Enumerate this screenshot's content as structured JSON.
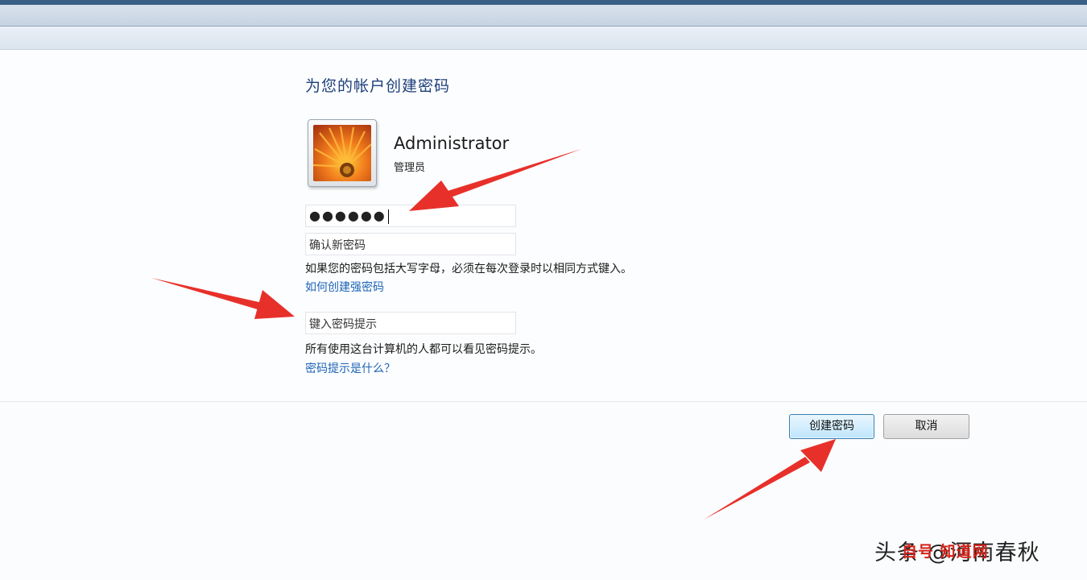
{
  "page": {
    "title": "为您的帐户创建密码"
  },
  "user": {
    "name": "Administrator",
    "role": "管理员",
    "avatar_icon": "flower-avatar-icon"
  },
  "form": {
    "password_value": "●●●●●●",
    "confirm_placeholder": "确认新密码",
    "caps_warning": "如果您的密码包括大写字母，必须在每次登录时以相同方式键入。",
    "create_strong_link": "如何创建强密码",
    "hint_placeholder": "键入密码提示",
    "hint_visibility_note": "所有使用这台计算机的人都可以看见密码提示。",
    "hint_help_link": "密码提示是什么？"
  },
  "buttons": {
    "create": "创建密码",
    "cancel": "取消"
  },
  "watermark": {
    "primary": "头条 @河南春秋",
    "secondary": "自号 知道网"
  },
  "colors": {
    "arrow": "#e8302a",
    "link": "#1c63b7",
    "title": "#1d3f7a"
  }
}
